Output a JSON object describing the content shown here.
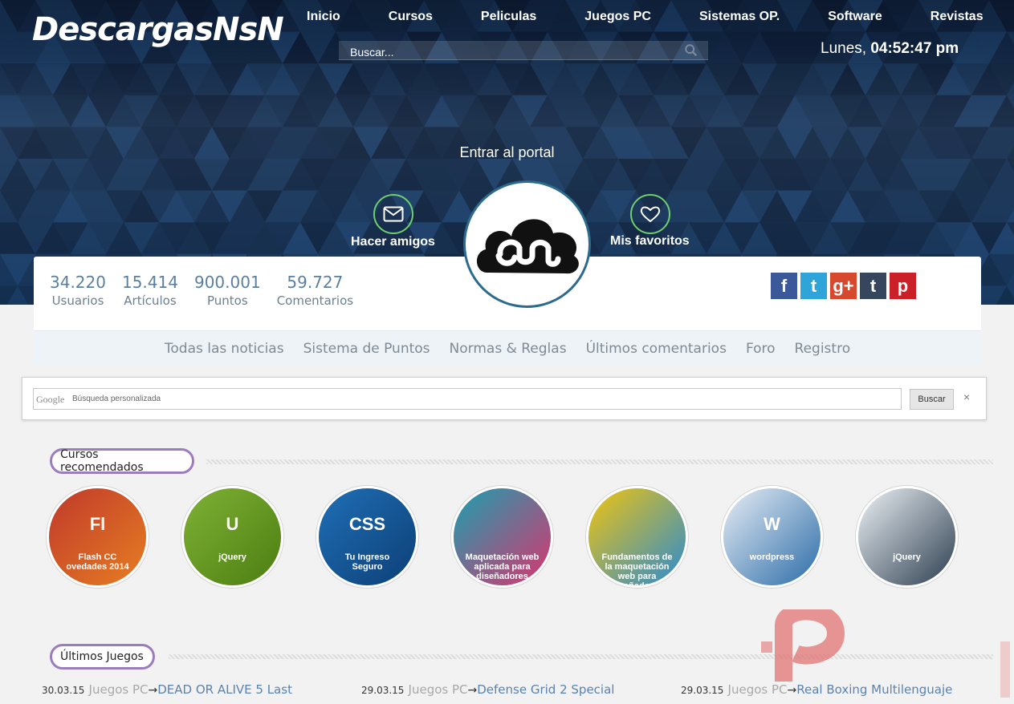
{
  "brand": {
    "logo_text": "DescargasNsN"
  },
  "top_nav": [
    "Inicio",
    "Cursos",
    "Peliculas",
    "Juegos PC",
    "Sistemas OP.",
    "Software",
    "Revistas"
  ],
  "search": {
    "placeholder": "Buscar..."
  },
  "clock": {
    "day": "Lunes,",
    "time": "04:52:47 pm"
  },
  "hero": {
    "enter_label": "Entrar al portal",
    "friends_label": "Hacer amigos",
    "favorites_label": "Mis favoritos"
  },
  "stats": [
    {
      "value": "34.220",
      "label": "Usuarios"
    },
    {
      "value": "15.414",
      "label": "Artículos"
    },
    {
      "value": "900.001",
      "label": "Puntos"
    },
    {
      "value": "59.727",
      "label": "Comentarios"
    }
  ],
  "social": [
    {
      "name": "facebook-icon",
      "glyph": "f",
      "color": "#3b5998"
    },
    {
      "name": "twitter-icon",
      "glyph": "t",
      "color": "#2fa4d9"
    },
    {
      "name": "googleplus-icon",
      "glyph": "g+",
      "color": "#d6492f"
    },
    {
      "name": "tumblr-icon",
      "glyph": "t",
      "color": "#36465d"
    },
    {
      "name": "pinterest-icon",
      "glyph": "p",
      "color": "#cb2027"
    }
  ],
  "sub_nav": [
    "Todas las noticias",
    "Sistema de Puntos",
    "Normas & Reglas",
    "Últimos comentarios",
    "Foro",
    "Registro"
  ],
  "google_search": {
    "logo": "Google",
    "placeholder": "Búsqueda personalizada",
    "button": "Buscar",
    "close": "×"
  },
  "sections": {
    "courses_title": "Cursos recomendados",
    "games_title": "Últimos Juegos"
  },
  "courses": [
    {
      "caption_top": "Fl",
      "caption_bottom": "Flash CC\novedades 2014",
      "color_a": "#c0392b",
      "color_b": "#e67e22"
    },
    {
      "caption_top": "U",
      "caption_bottom": "jQuery",
      "color_a": "#7fb235",
      "color_b": "#4c7d12"
    },
    {
      "caption_top": "CSS",
      "caption_bottom": "Tu Ingreso Seguro",
      "color_a": "#1f6fb6",
      "color_b": "#0d3f76"
    },
    {
      "caption_top": "",
      "caption_bottom": "Maquetación web aplicada para diseñadores",
      "color_a": "#1aa0b0",
      "color_b": "#d9356e"
    },
    {
      "caption_top": "",
      "caption_bottom": "Fundamentos de la maquetación web para diseñadores",
      "color_a": "#f1c40f",
      "color_b": "#2a8bd0"
    },
    {
      "caption_top": "W",
      "caption_bottom": "wordpress",
      "color_a": "#e8eef5",
      "color_b": "#2b6ca8"
    },
    {
      "caption_top": "",
      "caption_bottom": "jQuery",
      "color_a": "#eef2f6",
      "color_b": "#2c3e50"
    }
  ],
  "games": [
    {
      "date": "30.03.15",
      "category": "Juegos PC",
      "arrow": "→",
      "title": "DEAD OR ALIVE 5 Last"
    },
    {
      "date": "29.03.15",
      "category": "Juegos PC",
      "arrow": "→",
      "title": "Defense Grid 2 Special"
    },
    {
      "date": "29.03.15",
      "category": "Juegos PC",
      "arrow": "→",
      "title": "Real Boxing Multilenguaje"
    }
  ]
}
